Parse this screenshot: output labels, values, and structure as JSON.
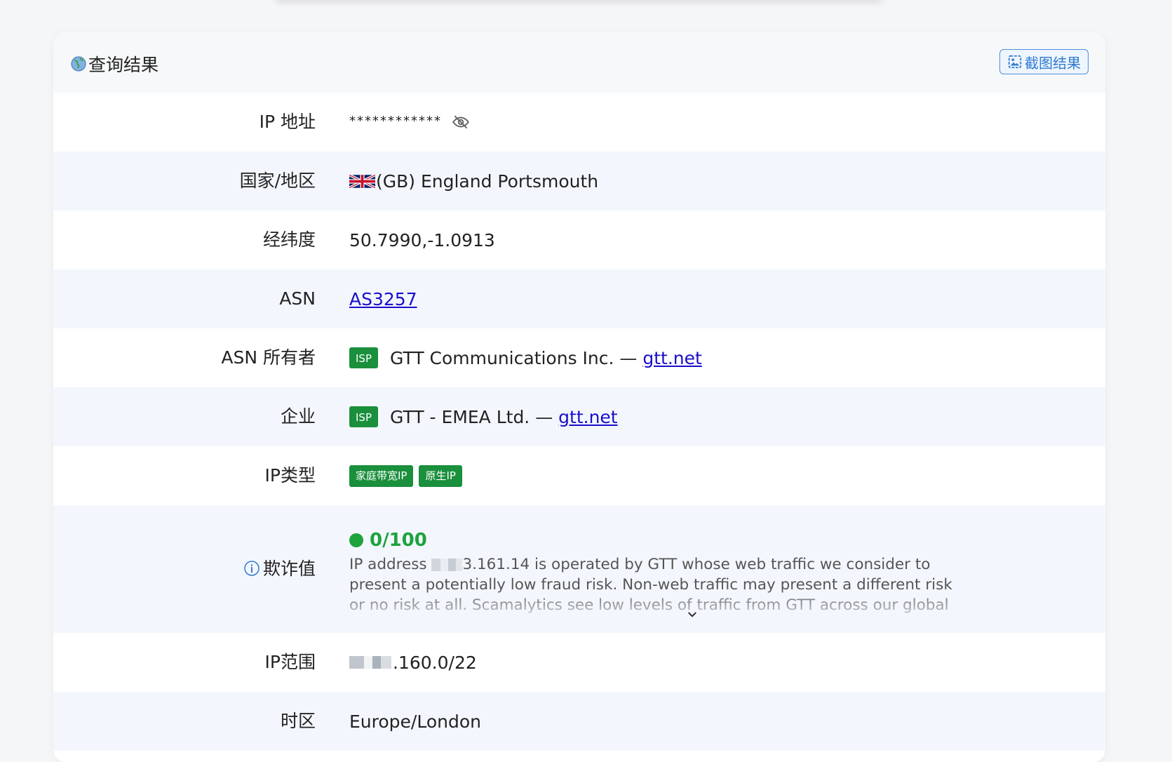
{
  "header": {
    "title": "查询结果",
    "screenshot_button": "截图结果"
  },
  "rows": {
    "ip": {
      "label": "IP 地址",
      "value": "************"
    },
    "country": {
      "label": "国家/地区",
      "value": "(GB) England Portsmouth"
    },
    "coords": {
      "label": "经纬度",
      "value": "50.7990,-1.0913"
    },
    "asn": {
      "label": "ASN",
      "value": "AS3257"
    },
    "asn_owner": {
      "label": "ASN 所有者",
      "badge": "ISP",
      "name": "GTT Communications Inc. —",
      "link": "gtt.net"
    },
    "org": {
      "label": "企业",
      "badge": "ISP",
      "name": "GTT - EMEA Ltd. —",
      "link": "gtt.net"
    },
    "ip_type": {
      "label": "IP类型",
      "tags": [
        "家庭带宽IP",
        "原生IP"
      ]
    },
    "fraud": {
      "label": "欺诈值",
      "score": "0/100",
      "text_prefix": "IP address",
      "text_rest": "3.161.14 is operated by GTT whose web traffic we consider to present a potentially low fraud risk. Non-web traffic may present a different risk or no risk at all. Scamalytics see low levels of traffic from GTT across our global network, little of which we"
    },
    "ip_range": {
      "label": "IP范围",
      "value": ".160.0/22"
    },
    "timezone": {
      "label": "时区",
      "value": "Europe/London"
    }
  },
  "colors": {
    "accent_green": "#1a8f3c",
    "score_green": "#1ea33d",
    "link_blue": "#1a0dcc",
    "button_blue": "#2f7bd1"
  }
}
